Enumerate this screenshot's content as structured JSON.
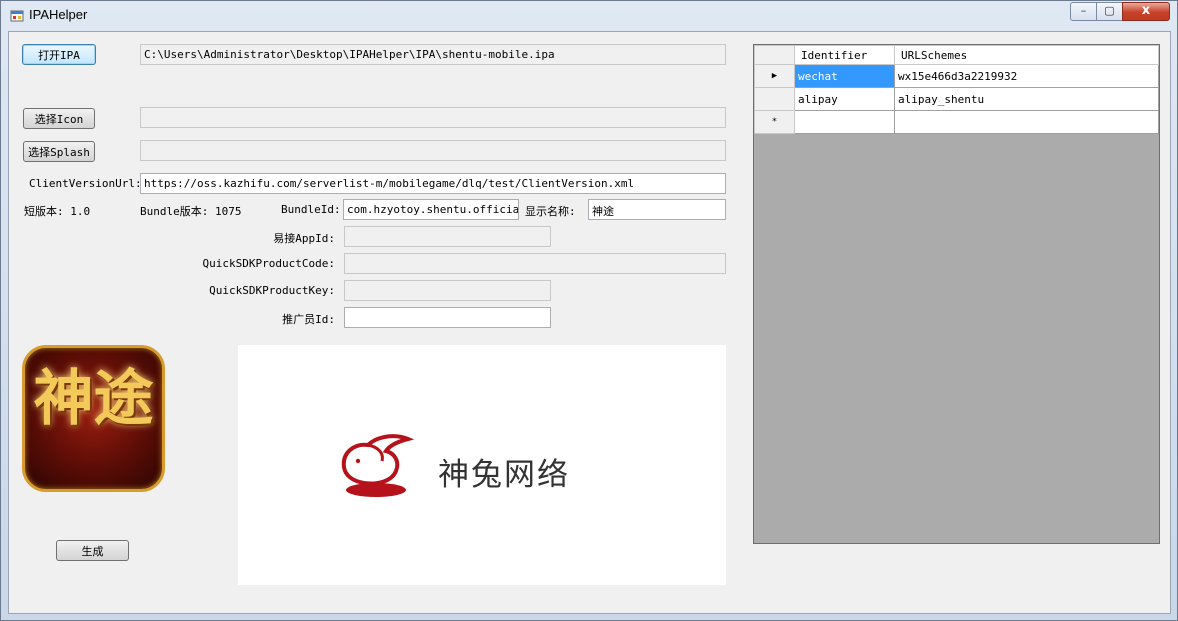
{
  "window": {
    "title": "IPAHelper",
    "minimize": "–",
    "maximize": "▢",
    "close": "x"
  },
  "ipa": {
    "button": "打开IPA",
    "path": "C:\\Users\\Administrator\\Desktop\\IPAHelper\\IPA\\shentu-mobile.ipa"
  },
  "icon": {
    "button": "选择Icon",
    "path": ""
  },
  "splash": {
    "button": "选择Splash",
    "path": ""
  },
  "client_version": {
    "label": "ClientVersionUrl:",
    "value": "https://oss.kazhifu.com/serverlist-m/mobilegame/dlq/test/ClientVersion.xml"
  },
  "info": {
    "short_version": "短版本: 1.0",
    "bundle_version": "Bundle版本: 1075",
    "bundle_id_label": "BundleId:",
    "bundle_id": "com.hzyotoy.shentu.official",
    "display_name_label": "显示名称:",
    "display_name": "神途"
  },
  "fields": {
    "yijie_label": "易接AppId:",
    "yijie": "",
    "quick_code_label": "QuickSDKProductCode:",
    "quick_code": "",
    "quick_key_label": "QuickSDKProductKey:",
    "quick_key": "",
    "promoter_label": "推广员Id:",
    "promoter": ""
  },
  "app_icon": {
    "glyph": "神途"
  },
  "splash_image": {
    "brand": "神兔网络",
    "accent": "#b5121b"
  },
  "generate_button": "生成",
  "grid": {
    "headers": [
      "Identifier",
      "URLSchemes"
    ],
    "rows": [
      {
        "marker": "▶",
        "identifier": "wechat",
        "scheme": "wx15e466d3a2219932"
      },
      {
        "marker": "",
        "identifier": "alipay",
        "scheme": "alipay_shentu"
      },
      {
        "marker": "*",
        "identifier": "",
        "scheme": ""
      }
    ]
  }
}
